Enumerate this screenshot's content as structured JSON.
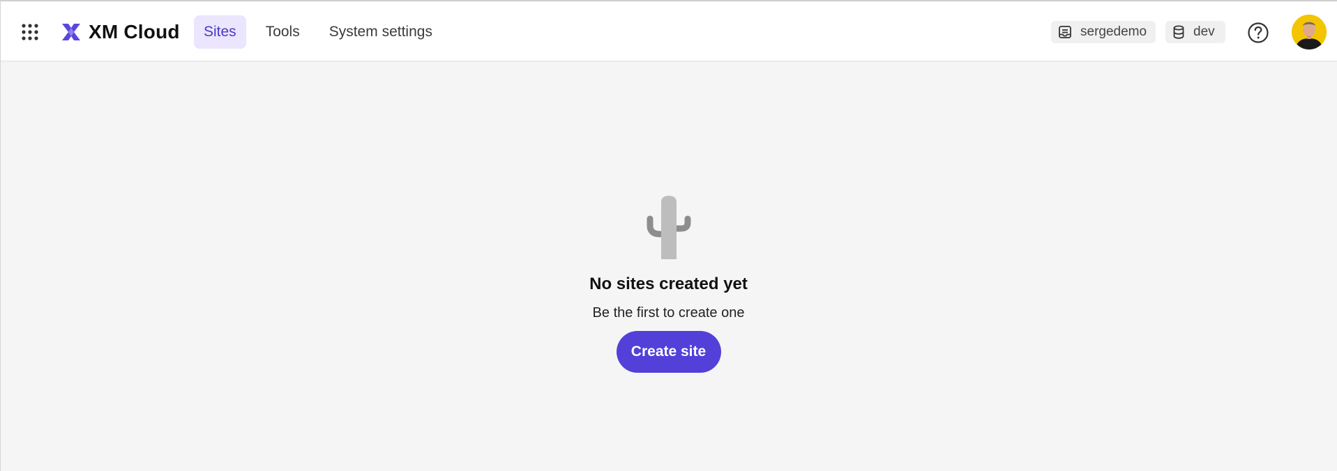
{
  "header": {
    "apps_icon": "grid-9-dots-icon",
    "logo_icon": "xm-cloud-logo-icon",
    "app_name": "XM Cloud",
    "nav": [
      {
        "label": "Sites",
        "active": true
      },
      {
        "label": "Tools",
        "active": false
      },
      {
        "label": "System settings",
        "active": false
      }
    ],
    "tenant": {
      "icon": "tenant-icon",
      "label": "sergedemo"
    },
    "environment": {
      "icon": "database-icon",
      "label": "dev"
    },
    "help_icon": "help-circle-icon",
    "avatar_icon": "user-avatar"
  },
  "empty_state": {
    "icon": "cactus-icon",
    "title": "No sites created yet",
    "subtitle": "Be the first to create one",
    "button_label": "Create site"
  },
  "colors": {
    "accent": "#5240d8",
    "nav_active_bg": "#ebe6fd",
    "nav_active_text": "#4a38c9",
    "page_bg": "#f5f5f5"
  }
}
